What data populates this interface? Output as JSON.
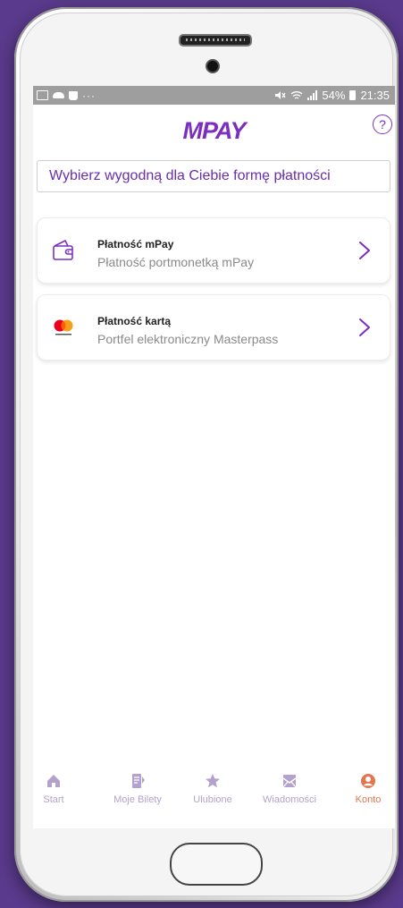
{
  "status_bar": {
    "left_icons": [
      "gallery-icon",
      "cloud-icon",
      "bag-icon"
    ],
    "more": "···",
    "battery": "54%",
    "time": "21:35"
  },
  "app": {
    "logo": "MPAY",
    "help": "?"
  },
  "heading": "Wybierz wygodną dla Ciebie formę płatności",
  "options": [
    {
      "title": "Płatność mPay",
      "subtitle": "Płatność portmonetką mPay",
      "icon": "wallet-icon"
    },
    {
      "title": "Płatność kartą",
      "subtitle": "Portfel elektroniczny Masterpass",
      "icon": "masterpass-icon"
    }
  ],
  "nav": [
    {
      "label": "Start",
      "icon": "home-icon"
    },
    {
      "label": "Moje Bilety",
      "icon": "tickets-icon"
    },
    {
      "label": "Ulubione",
      "icon": "star-icon"
    },
    {
      "label": "Wiadomości",
      "icon": "mail-icon"
    },
    {
      "label": "Konto",
      "icon": "user-icon"
    }
  ],
  "colors": {
    "accent": "#7b2fbf",
    "nav_inactive": "#b3a2cc",
    "nav_active": "#e0774f",
    "background": "#5a3a8c"
  }
}
